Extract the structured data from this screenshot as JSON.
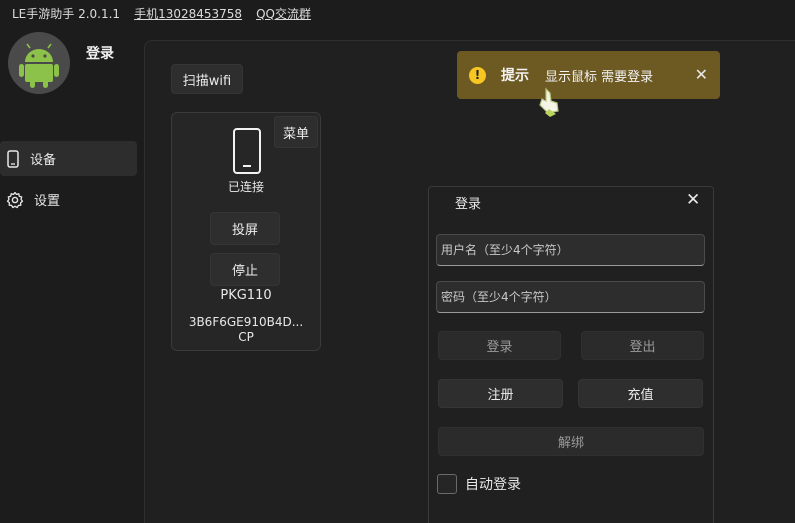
{
  "titlebar": {
    "app_title": "LE手游助手 2.0.1.1",
    "phone_link": "手机13028453758",
    "qq_link": "QQ交流群"
  },
  "sidebar": {
    "login_label": "登录",
    "items": [
      {
        "label": "设备",
        "icon": "phone-icon",
        "active": true
      },
      {
        "label": "设置",
        "icon": "gear-icon",
        "active": false
      }
    ]
  },
  "main": {
    "scan_wifi_label": "扫描wifi",
    "device": {
      "menu_label": "菜单",
      "status": "已连接",
      "cast_label": "投屏",
      "stop_label": "停止",
      "model": "PKG110",
      "serial": "3B6F6GE910B4D...",
      "serial_suffix": "CP"
    }
  },
  "toast": {
    "title": "提示",
    "message": "显示鼠标 需要登录",
    "icon": "warning-icon",
    "accent": "#6d5a23"
  },
  "login_dialog": {
    "title": "登录",
    "username_placeholder": "用户名（至少4个字符）",
    "password_placeholder": "密码（至少4个字符）",
    "login_label": "登录",
    "logout_label": "登出",
    "register_label": "注册",
    "recharge_label": "充值",
    "unbind_label": "解绑",
    "auto_login_label": "自动登录"
  }
}
